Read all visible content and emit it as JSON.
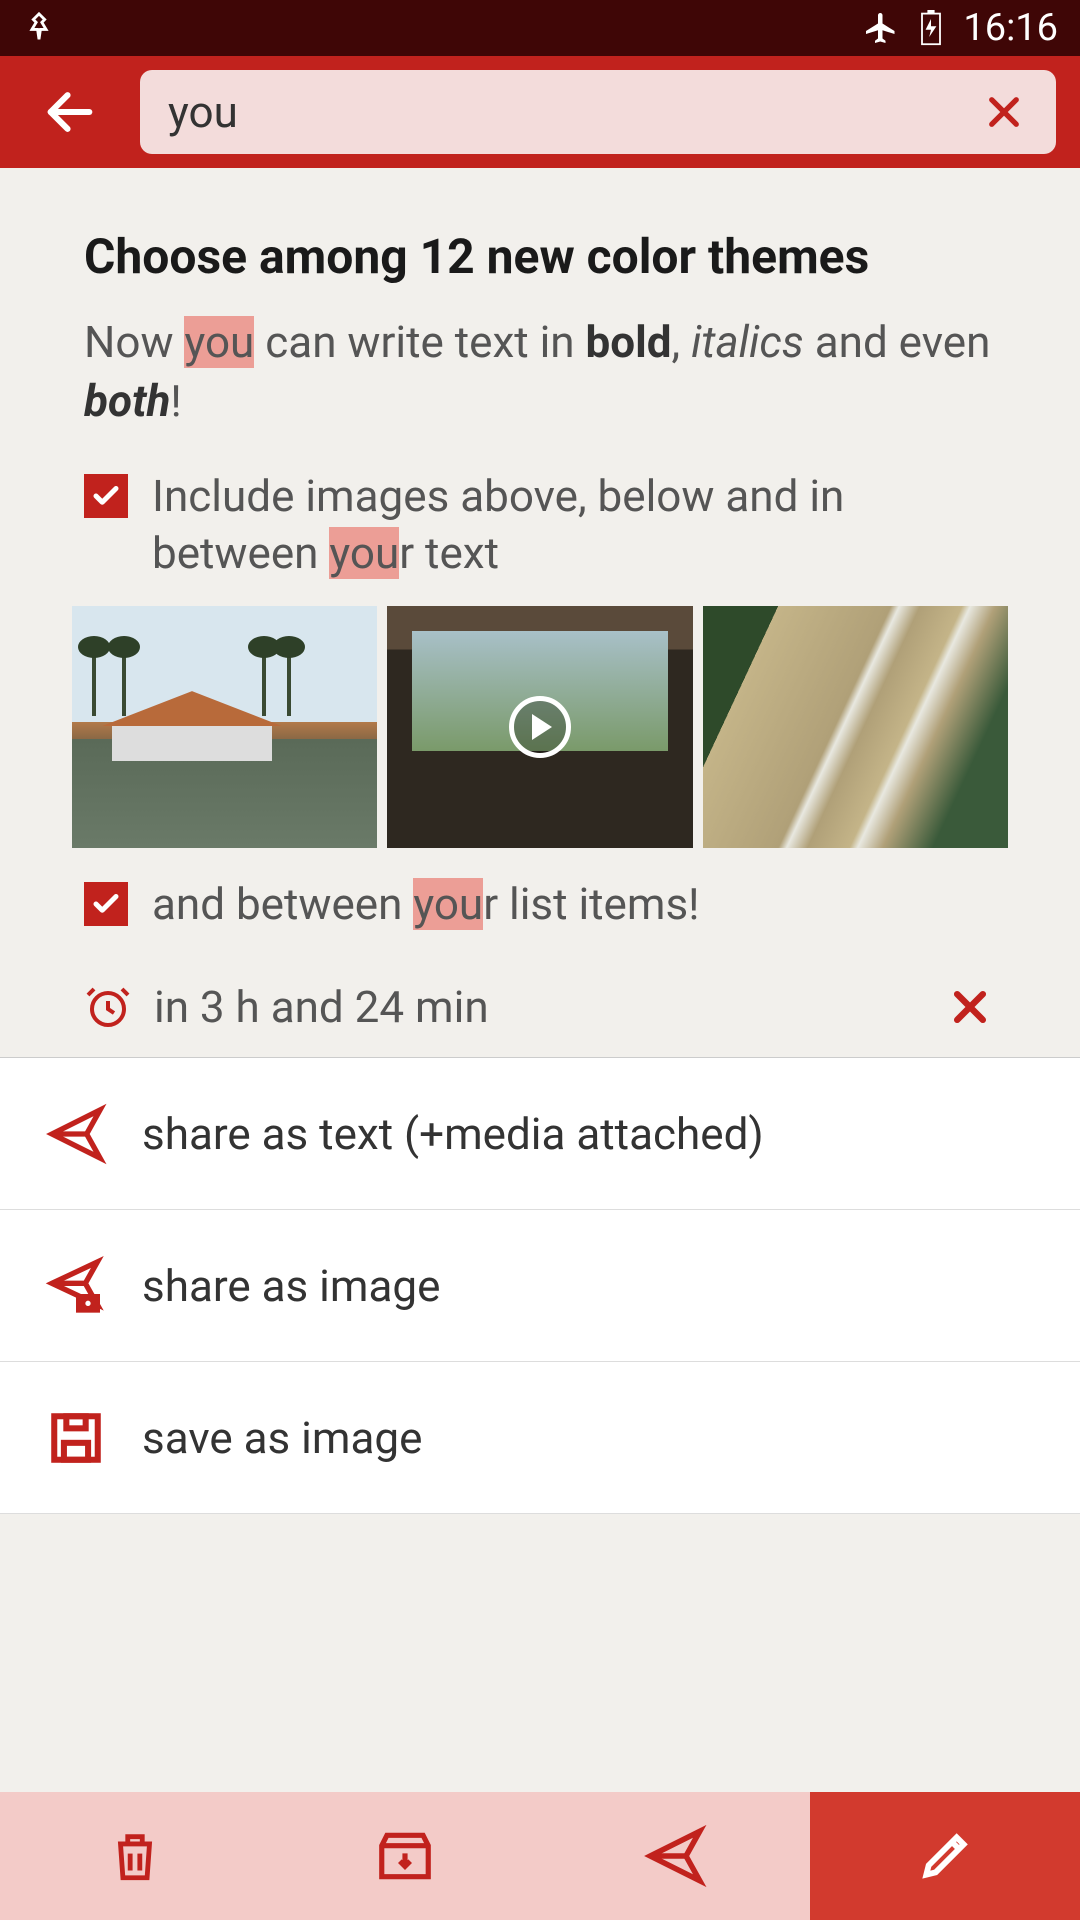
{
  "status": {
    "time": "16:16"
  },
  "search": {
    "value": "you"
  },
  "note": {
    "title": "Choose among 12 new color themes",
    "body_pre": "Now ",
    "body_hl1": "you",
    "body_mid1": " can write text in ",
    "body_bold": "bold",
    "body_mid2": ", ",
    "body_italic": "italics",
    "body_mid3": " and even ",
    "body_both": "both",
    "body_post": "!",
    "check1_pre": "Include images above, below and in between ",
    "check1_hl": "you",
    "check1_post": "r text",
    "check2_pre": "and between ",
    "check2_hl": "you",
    "check2_post": "r list items!",
    "reminder": "in 3 h and 24 min"
  },
  "actions": {
    "share_text": "share as text (+media attached)",
    "share_image": "share as image",
    "save_image": "save as image"
  },
  "colors": {
    "accent": "#c1221d"
  }
}
